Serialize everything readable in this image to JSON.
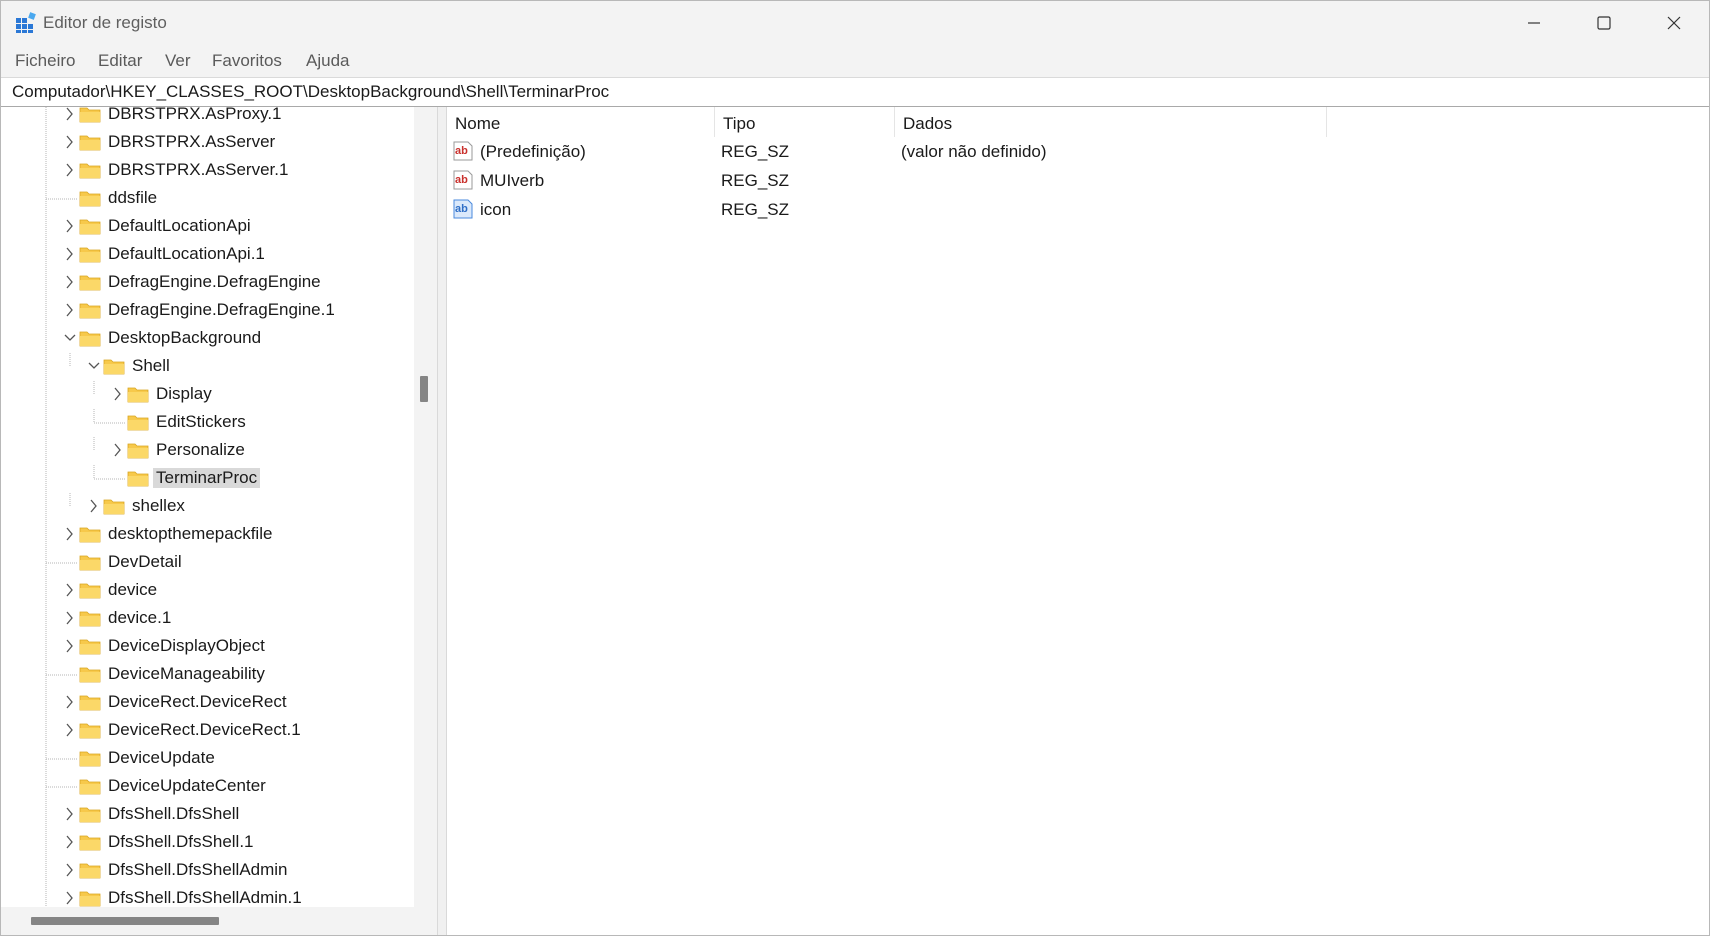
{
  "window": {
    "title": "Editor de registo",
    "controls": {
      "minimize": "minimize",
      "maximize": "maximize",
      "close": "close"
    }
  },
  "menu": [
    "Ficheiro",
    "Editar",
    "Ver",
    "Favoritos",
    "Ajuda"
  ],
  "address": "Computador\\HKEY_CLASSES_ROOT\\DesktopBackground\\Shell\\TerminarProc",
  "tree": [
    {
      "label": "DBRSTPRX.AsProxy.1",
      "level": 0,
      "expander": "collapsed"
    },
    {
      "label": "DBRSTPRX.AsServer",
      "level": 0,
      "expander": "collapsed"
    },
    {
      "label": "DBRSTPRX.AsServer.1",
      "level": 0,
      "expander": "collapsed"
    },
    {
      "label": "ddsfile",
      "level": 0,
      "expander": "none"
    },
    {
      "label": "DefaultLocationApi",
      "level": 0,
      "expander": "collapsed"
    },
    {
      "label": "DefaultLocationApi.1",
      "level": 0,
      "expander": "collapsed"
    },
    {
      "label": "DefragEngine.DefragEngine",
      "level": 0,
      "expander": "collapsed"
    },
    {
      "label": "DefragEngine.DefragEngine.1",
      "level": 0,
      "expander": "collapsed"
    },
    {
      "label": "DesktopBackground",
      "level": 0,
      "expander": "expanded"
    },
    {
      "label": "Shell",
      "level": 1,
      "expander": "expanded"
    },
    {
      "label": "Display",
      "level": 2,
      "expander": "collapsed"
    },
    {
      "label": "EditStickers",
      "level": 2,
      "expander": "none"
    },
    {
      "label": "Personalize",
      "level": 2,
      "expander": "collapsed"
    },
    {
      "label": "TerminarProc",
      "level": 2,
      "expander": "none",
      "selected": true
    },
    {
      "label": "shellex",
      "level": 1,
      "expander": "collapsed"
    },
    {
      "label": "desktopthemepackfile",
      "level": 0,
      "expander": "collapsed"
    },
    {
      "label": "DevDetail",
      "level": 0,
      "expander": "none"
    },
    {
      "label": "device",
      "level": 0,
      "expander": "collapsed"
    },
    {
      "label": "device.1",
      "level": 0,
      "expander": "collapsed"
    },
    {
      "label": "DeviceDisplayObject",
      "level": 0,
      "expander": "collapsed"
    },
    {
      "label": "DeviceManageability",
      "level": 0,
      "expander": "none"
    },
    {
      "label": "DeviceRect.DeviceRect",
      "level": 0,
      "expander": "collapsed"
    },
    {
      "label": "DeviceRect.DeviceRect.1",
      "level": 0,
      "expander": "collapsed"
    },
    {
      "label": "DeviceUpdate",
      "level": 0,
      "expander": "none"
    },
    {
      "label": "DeviceUpdateCenter",
      "level": 0,
      "expander": "none"
    },
    {
      "label": "DfsShell.DfsShell",
      "level": 0,
      "expander": "collapsed"
    },
    {
      "label": "DfsShell.DfsShell.1",
      "level": 0,
      "expander": "collapsed"
    },
    {
      "label": "DfsShell.DfsShellAdmin",
      "level": 0,
      "expander": "collapsed"
    },
    {
      "label": "DfsShell.DfsShellAdmin.1",
      "level": 0,
      "expander": "collapsed"
    }
  ],
  "values": {
    "columns": [
      "Nome",
      "Tipo",
      "Dados"
    ],
    "rows": [
      {
        "name": "(Predefinição)",
        "type": "REG_SZ",
        "data": "(valor não definido)",
        "icon": "string-value-icon"
      },
      {
        "name": "MUIverb",
        "type": "REG_SZ",
        "data": "",
        "icon": "string-value-icon"
      },
      {
        "name": "icon",
        "type": "REG_SZ",
        "data": "",
        "icon": "string-value-icon-selected"
      }
    ]
  },
  "colors": {
    "folder": "#f7c94b",
    "selection": "#d9d9d9",
    "ab_red": "#c9302c",
    "ab_selected": "#4a89dc"
  }
}
